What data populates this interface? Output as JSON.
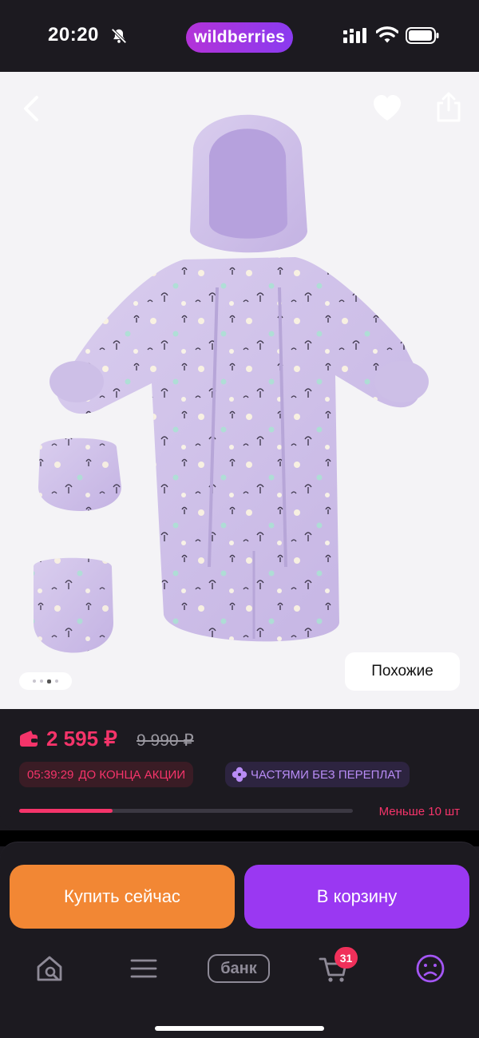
{
  "status_bar": {
    "time": "20:20",
    "brand": "wildberries",
    "icons": [
      "bell-off-icon",
      "signal-icon",
      "wifi-icon",
      "battery-icon"
    ]
  },
  "product_gallery": {
    "image_subject": "lavender baby snowsuit with mittens and booties",
    "total_images": 4,
    "active_image_index": 3,
    "similar_label": "Похожие",
    "icons": [
      "back-arrow-icon",
      "heart-icon",
      "share-icon"
    ]
  },
  "price": {
    "current": "2 595 ₽",
    "old": "9 990 ₽",
    "timer": "05:39:29",
    "timer_label": "ДО КОНЦА АКЦИИ",
    "installment_label": "ЧАСТЯМИ БЕЗ ПЕРЕПЛАТ",
    "stock_fraction": 0.28,
    "stock_label": "Меньше 10 шт"
  },
  "actions": {
    "buy_now": "Купить сейчас",
    "add_to_cart": "В корзину"
  },
  "tab_bar": {
    "items": [
      "home-search-icon",
      "menu-icon",
      "bank",
      "cart-icon",
      "profile-icon"
    ],
    "bank_label": "банк",
    "cart_count": "31"
  },
  "colors": {
    "accent_pink": "#f5346a",
    "brand_purple": "#9a38f2",
    "orange": "#f28734",
    "background": "#1c1a20"
  }
}
